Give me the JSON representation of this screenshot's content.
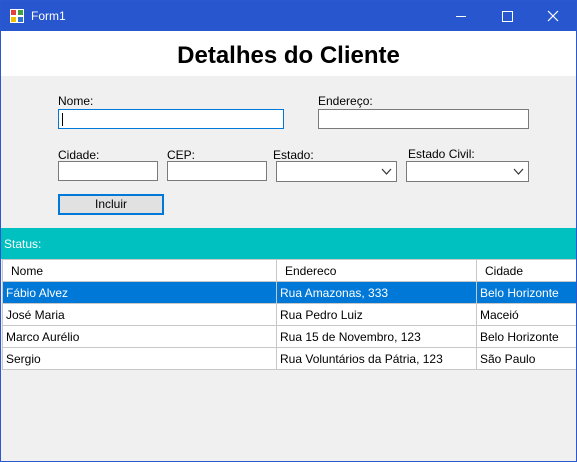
{
  "window": {
    "title": "Form1"
  },
  "header": {
    "title": "Detalhes do Cliente"
  },
  "form": {
    "nome_label": "Nome:",
    "endereco_label": "Endereço:",
    "cidade_label": "Cidade:",
    "cep_label": "CEP:",
    "estado_label": "Estado:",
    "estado_civil_label": "Estado Civil:",
    "nome_value": "",
    "endereco_value": "",
    "cidade_value": "",
    "cep_value": "",
    "estado_value": "",
    "estado_civil_value": "",
    "incluir_label": "Incluir"
  },
  "status": {
    "text": "Status:"
  },
  "grid": {
    "columns": [
      "Nome",
      "Endereco",
      "Cidade"
    ],
    "rows": [
      [
        "Fábio Alvez",
        "Rua Amazonas, 333",
        "Belo Horizonte"
      ],
      [
        "José Maria",
        "Rua Pedro Luiz",
        "Maceió"
      ],
      [
        "Marco Aurélio",
        "Rua 15 de Novembro, 123",
        "Belo Horizonte"
      ],
      [
        "Sergio",
        "Rua Voluntários da Pátria, 123",
        "São Paulo"
      ]
    ],
    "selected_row": 0
  },
  "colors": {
    "titlebar": "#2756cf",
    "status": "#00c0c0",
    "selection": "#0078d7"
  },
  "icons": [
    "app-icon",
    "minimize-icon",
    "maximize-icon",
    "close-icon",
    "chevron-down-icon"
  ]
}
